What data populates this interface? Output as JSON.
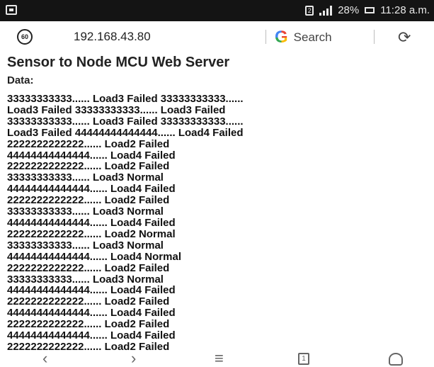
{
  "status_bar": {
    "sim_label": "2",
    "battery": "28%",
    "time": "11:28 a.m."
  },
  "browser": {
    "url": "192.168.43.80",
    "search_label": "Search"
  },
  "page": {
    "title": "Sensor to Node MCU Web Server",
    "data_label": "Data:",
    "lines": [
      "33333333333...... Load3 Failed 33333333333......",
      "Load3 Failed 33333333333...... Load3 Failed",
      "33333333333...... Load3 Failed 33333333333......",
      "Load3 Failed 44444444444444...... Load4 Failed",
      "2222222222222...... Load2 Failed",
      "44444444444444...... Load4 Failed",
      "2222222222222...... Load2 Failed",
      "33333333333...... Load3 Normal",
      "44444444444444...... Load4 Failed",
      "2222222222222...... Load2 Failed",
      "33333333333...... Load3 Normal",
      "44444444444444...... Load4 Failed",
      "2222222222222...... Load2 Normal",
      "33333333333...... Load3 Normal",
      "44444444444444...... Load4 Normal",
      "2222222222222...... Load2 Failed",
      "33333333333...... Load3 Normal",
      "44444444444444...... Load4 Failed",
      "2222222222222...... Load2 Failed",
      "44444444444444...... Load4 Failed",
      "2222222222222...... Load2 Failed",
      "44444444444444...... Load4 Failed",
      "2222222222222...... Load2 Failed",
      "44444444444444...... Load4 Failed",
      "2222222222222...... Load2 Failed"
    ]
  },
  "nav_bar": {
    "tab_count": "1"
  }
}
